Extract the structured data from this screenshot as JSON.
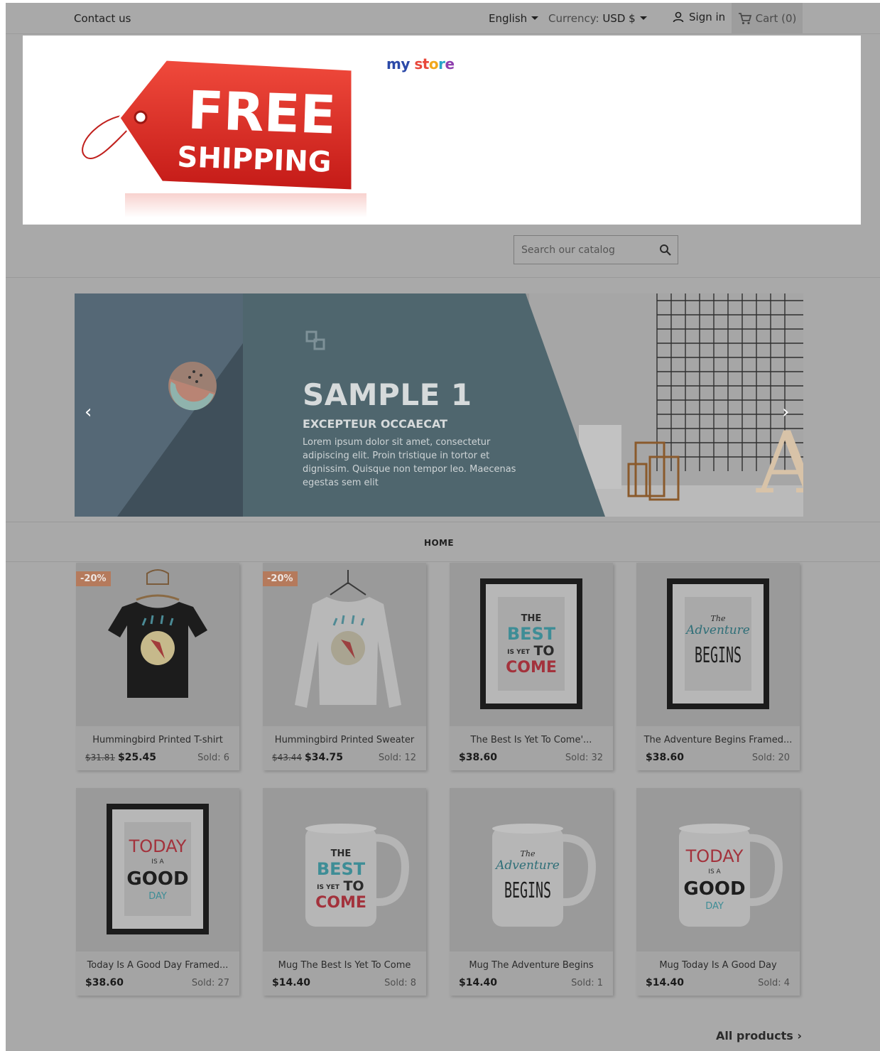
{
  "topnav": {
    "contact": "Contact us",
    "language": "English",
    "currency_label": "Currency:",
    "currency_value": "USD $",
    "signin": "Sign in",
    "cart": "Cart (0)"
  },
  "header": {
    "banner_line1": "FREE",
    "banner_line2": "SHIPPING",
    "brand": {
      "my": "my",
      "st": "st",
      "o": "o",
      "r": "r",
      "e": "e"
    }
  },
  "search": {
    "placeholder": "Search our catalog"
  },
  "slider": {
    "title": "SAMPLE 1",
    "subtitle": "EXCEPTEUR OCCAECAT",
    "text": "Lorem ipsum dolor sit amet, consectetur adipiscing elit. Proin tristique in tortor et dignissim. Quisque non tempor leo. Maecenas egestas sem elit",
    "prev": "‹",
    "next": "›"
  },
  "menu": {
    "home": "HOME"
  },
  "products": [
    {
      "name": "Hummingbird Printed T-shirt",
      "old_price": "$31.81",
      "price": "$25.45",
      "sold": "Sold: 6",
      "badge": "-20%",
      "art": "tshirt-dark"
    },
    {
      "name": "Hummingbird Printed Sweater",
      "old_price": "$43.44",
      "price": "$34.75",
      "sold": "Sold: 12",
      "badge": "-20%",
      "art": "sweater"
    },
    {
      "name": "The Best Is Yet To Come'...",
      "old_price": "",
      "price": "$38.60",
      "sold": "Sold: 32",
      "badge": "",
      "art": "frame-best"
    },
    {
      "name": "The Adventure Begins Framed...",
      "old_price": "",
      "price": "$38.60",
      "sold": "Sold: 20",
      "badge": "",
      "art": "frame-adventure"
    },
    {
      "name": "Today Is A Good Day Framed...",
      "old_price": "",
      "price": "$38.60",
      "sold": "Sold: 27",
      "badge": "",
      "art": "frame-today"
    },
    {
      "name": "Mug The Best Is Yet To Come",
      "old_price": "",
      "price": "$14.40",
      "sold": "Sold: 8",
      "badge": "",
      "art": "mug-best"
    },
    {
      "name": "Mug The Adventure Begins",
      "old_price": "",
      "price": "$14.40",
      "sold": "Sold: 1",
      "badge": "",
      "art": "mug-adventure"
    },
    {
      "name": "Mug Today Is A Good Day",
      "old_price": "",
      "price": "$14.40",
      "sold": "Sold: 4",
      "badge": "",
      "art": "mug-today"
    }
  ],
  "product_art_text": {
    "best": [
      "THE",
      "BEST",
      "IS YET",
      "TO",
      "COME"
    ],
    "adventure": [
      "The",
      "Adventure",
      "BEGINS"
    ],
    "today": [
      "TODAY",
      "IS A",
      "GOOD",
      "DAY"
    ]
  },
  "all_products": "All products"
}
